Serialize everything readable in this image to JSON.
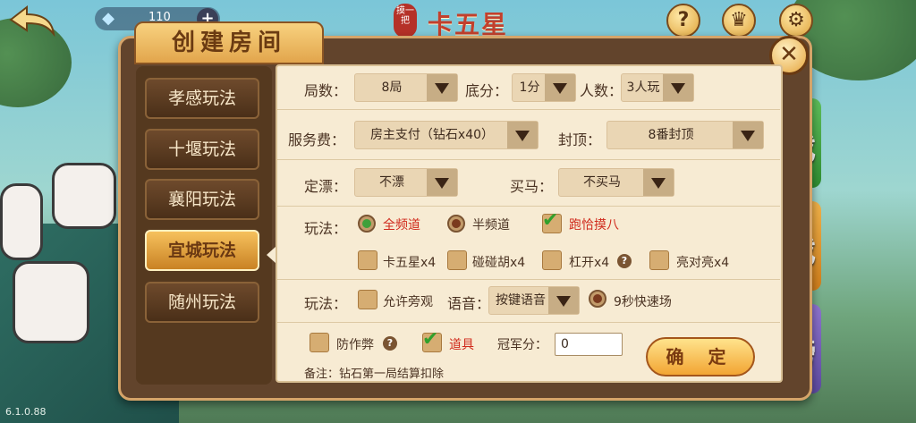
{
  "top_bar": {
    "diamond_count": "110",
    "plus_label": "+",
    "game_seal": "摸一把",
    "game_title": "卡五星",
    "rules_label": "玩法",
    "record_label": "战绩"
  },
  "background": {
    "side_btn_1": "戏",
    "side_btn_2": "戏",
    "side_btn_3": "榜"
  },
  "dialog": {
    "title": "创建房间",
    "close_icon": "close-icon"
  },
  "tabs": [
    {
      "label": "孝感玩法",
      "active": false
    },
    {
      "label": "十堰玩法",
      "active": false
    },
    {
      "label": "襄阳玩法",
      "active": false
    },
    {
      "label": "宜城玩法",
      "active": true
    },
    {
      "label": "随州玩法",
      "active": false
    }
  ],
  "form": {
    "rounds_label": "局数：",
    "rounds_value": "8局",
    "base_label": "底分：",
    "base_value": "1分",
    "players_label": "人数：",
    "players_value": "3人玩",
    "fee_label": "服务费：",
    "fee_value": "房主支付（钻石x40）",
    "cap_label": "封顶：",
    "cap_value": "8番封顶",
    "piao_label": "定漂：",
    "piao_value": "不漂",
    "maima_label": "买马：",
    "maima_value": "不买马",
    "play_label_1": "玩法：",
    "channel_full": "全频道",
    "channel_half": "半频道",
    "paoqia": "跑恰摸八",
    "kawuxing": "卡五星x4",
    "pengpenghu": "碰碰胡x4",
    "gangkai": "杠开x4",
    "liangduiliang": "亮对亮x4",
    "play_label_2": "玩法：",
    "allow_watch": "允许旁观",
    "voice_label": "语音：",
    "voice_value": "按键语音",
    "fast_mode": "9秒快速场",
    "anti_cheat": "防作弊",
    "props": "道具",
    "champion_label": "冠军分：",
    "champion_value": "0",
    "note": "备注：钻石第一局结算扣除",
    "confirm": "确 定"
  },
  "version": "6.1.0.88",
  "colors": {
    "accent_gold": "#f2a533",
    "panel_brown": "#62442c",
    "content_cream": "#f7ebd3",
    "check_green": "#31a02c",
    "selected_red": "#d02a1c"
  }
}
